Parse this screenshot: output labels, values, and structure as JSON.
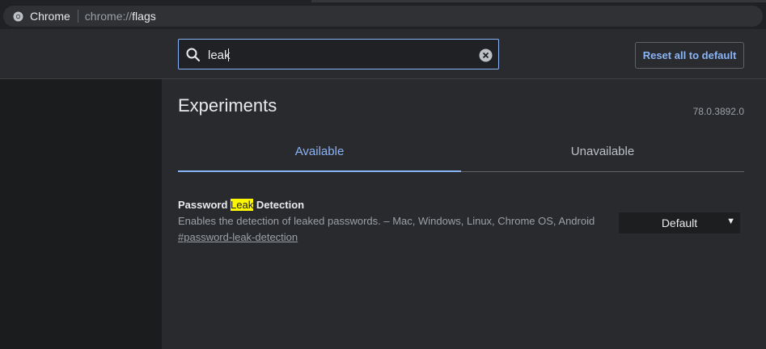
{
  "omnibox": {
    "site_label": "Chrome",
    "url_scheme": "chrome://",
    "url_path": "flags"
  },
  "search": {
    "value": "leak",
    "placeholder": "Search flags"
  },
  "header": {
    "reset_label": "Reset all to default"
  },
  "main": {
    "title": "Experiments",
    "version": "78.0.3892.0",
    "tabs": [
      {
        "label": "Available",
        "active": true
      },
      {
        "label": "Unavailable",
        "active": false
      }
    ]
  },
  "experiment": {
    "name_before": "Password ",
    "name_highlight": "Leak",
    "name_after": " Detection",
    "description": "Enables the detection of leaked passwords. – Mac, Windows, Linux, Chrome OS, Android",
    "link": "#password-leak-detection",
    "select_value": "Default"
  },
  "colors": {
    "accent": "#8ab4f8",
    "highlight": "#fcf700",
    "background": "#202124"
  }
}
